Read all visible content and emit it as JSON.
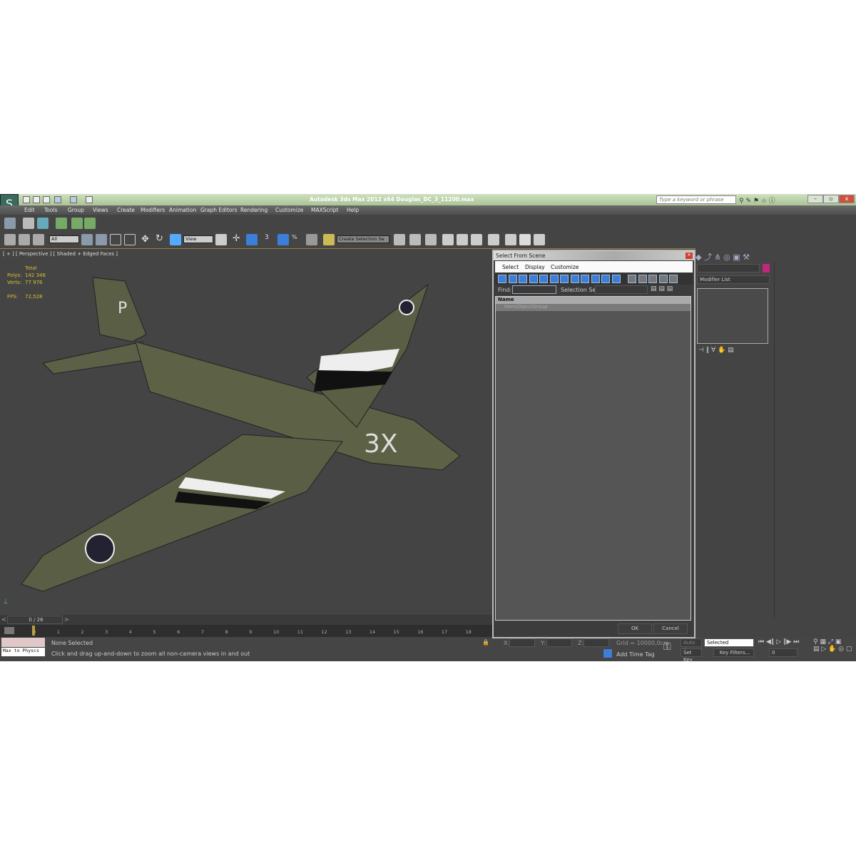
{
  "window": {
    "title": "Autodesk 3ds Max  2012 x64     Douglas_DC_3_11200.max",
    "search_placeholder": "Type a keyword or phrase",
    "minimize": "–",
    "restore": "▫",
    "close": "x"
  },
  "menu": [
    "Edit",
    "Tools",
    "Group",
    "Views",
    "Create",
    "Modifiers",
    "Animation",
    "Graph Editors",
    "Rendering",
    "Customize",
    "MAXScript",
    "Help"
  ],
  "toolbar": {
    "selection_filter": "All",
    "reference_coord": "View",
    "snap_label": "3",
    "named_selection": "Create Selection Se"
  },
  "viewport": {
    "label": "[ + ] [ Perspective ] [ Shaded + Edged Faces ]",
    "stats": {
      "header": "Total",
      "polys_label": "Polys:",
      "polys": "142 346",
      "verts_label": "Verts:",
      "verts": "77 976",
      "fps_label": "FPS:",
      "fps": "72,528"
    },
    "plane_markings": "3X",
    "tail_letter": "P"
  },
  "dialog": {
    "title": "Select From Scene",
    "menu": [
      "Select",
      "Display",
      "Customize"
    ],
    "find_label": "Find:",
    "find_value": "",
    "selection_set_label": "Selection Set:",
    "column_name": "Name",
    "items": [
      "HeroObjectGroup"
    ],
    "ok": "OK",
    "cancel": "Cancel"
  },
  "command_panel": {
    "modifier_list": "Modifier List",
    "color_swatch": "#c0287a"
  },
  "timeline": {
    "frame": "0 / 26",
    "ticks": [
      "0",
      "1",
      "2",
      "3",
      "4",
      "5",
      "6",
      "7",
      "8",
      "9",
      "10",
      "11",
      "12",
      "13",
      "14",
      "15",
      "16",
      "17",
      "18"
    ]
  },
  "status": {
    "script_listener": "Max to Physcs",
    "selection": "None Selected",
    "prompt": "Click and drag up-and-down to zoom all non-camera views in and out",
    "x_label": "X:",
    "y_label": "Y:",
    "z_label": "Z:",
    "grid": "Grid = 10000,0cm",
    "add_time_tag": "Add Time Tag",
    "auto_key": "Auto Key",
    "set_key": "Set Key",
    "key_mode": "Selected",
    "key_filters": "Key Filters...",
    "current_frame": "0"
  },
  "colors": {
    "accent": "#3c7ed8",
    "title_bar": "#b9d1a6",
    "viewport_bg": "#444444",
    "stats": "#d8c030"
  }
}
